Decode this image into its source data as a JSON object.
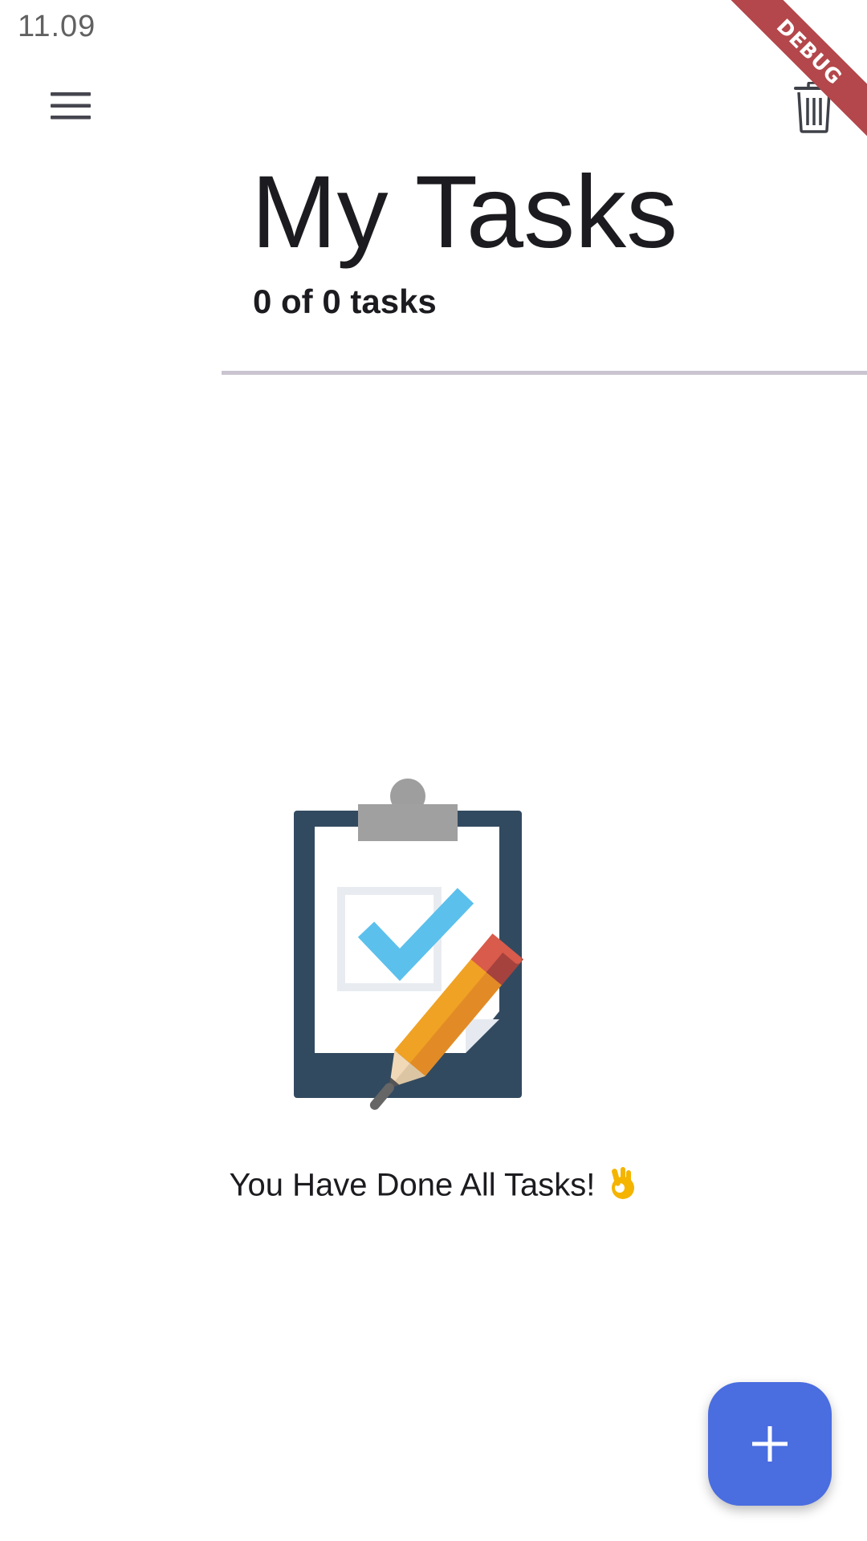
{
  "status_bar": {
    "time": "11.09"
  },
  "app_bar": {
    "menu_icon": "hamburger-menu-icon",
    "delete_icon": "trash-icon"
  },
  "debug_banner": {
    "label": "DEBUG",
    "color": "#b3474b"
  },
  "header": {
    "title": "My Tasks",
    "task_summary": "0 of 0 tasks"
  },
  "empty_state": {
    "illustration": "clipboard-with-check-and-pencil",
    "message": "You Have Done All Tasks!",
    "emoji_icon": "ok-hand-emoji-icon"
  },
  "fab": {
    "icon": "plus-icon",
    "color": "#4a6de0"
  },
  "colors": {
    "text_primary": "#1c1b1f",
    "divider": "#cac4d0",
    "accent": "#4a6de0"
  }
}
